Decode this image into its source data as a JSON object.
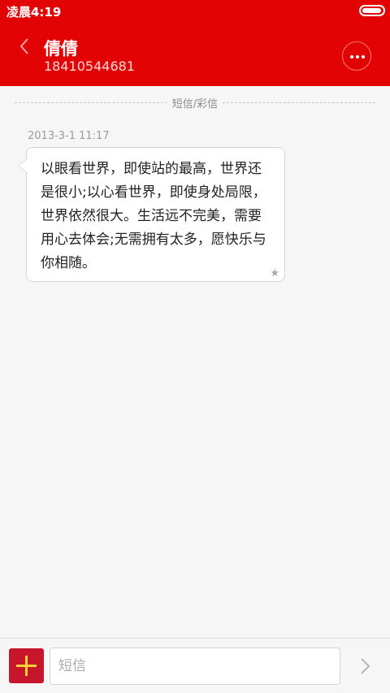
{
  "status_bar": {
    "time": "凌晨4:19",
    "battery_level": 0.95
  },
  "header": {
    "title": "倩倩",
    "phone": "18410544681",
    "back_icon": "chevron-left-icon",
    "more_icon": "more-dots-icon"
  },
  "conversation": {
    "divider_label": "短信/彩信",
    "messages": [
      {
        "timestamp": "2013-3-1 11:17",
        "text": "以眼看世界，即使站的最高，世界还是很小;以心看世界，即使身处局限，世界依然很大。生活远不完美，需要用心去体会;无需拥有太多，愿快乐与你相随。",
        "star_icon": "star-icon"
      }
    ]
  },
  "composer": {
    "add_icon": "plus-icon",
    "placeholder": "短信",
    "value": "",
    "send_icon": "chevron-right-icon"
  },
  "colors": {
    "brand_red": "#e20404",
    "add_button": "#c7162b",
    "add_plus": "#ffcf3a"
  }
}
